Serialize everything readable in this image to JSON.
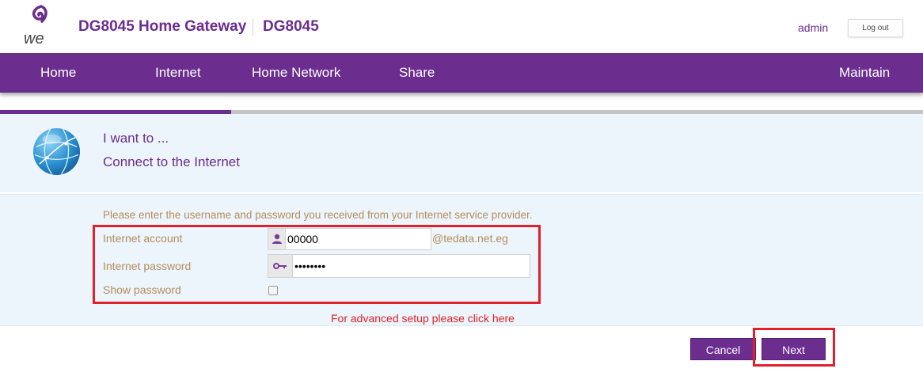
{
  "header": {
    "title": "DG8045 Home Gateway",
    "model": "DG8045",
    "user": "admin",
    "logout_label": "Log out"
  },
  "nav": {
    "items": [
      "Home",
      "Internet",
      "Home Network",
      "Share",
      "Maintain"
    ]
  },
  "wizard": {
    "progress_fraction": 0.25,
    "intro_line1": "I want to ...",
    "intro_line2": "Connect to the Internet",
    "instruction": "Please enter the username and password you received from your Internet service provider.",
    "account_label": "Internet account",
    "account_value": "00000",
    "account_suffix": "@tedata.net.eg",
    "password_label": "Internet password",
    "password_value": "********",
    "show_password_label": "Show password",
    "show_password_checked": false,
    "advanced_link": "For advanced setup please click here"
  },
  "buttons": {
    "cancel": "Cancel",
    "next": "Next"
  },
  "colors": {
    "brand": "#6b2d8e",
    "label": "#b68c5d",
    "highlight": "#e0202a",
    "panel": "#ecf5fb"
  },
  "icons": [
    "we-logo",
    "globe-icon",
    "user-icon",
    "key-icon"
  ]
}
